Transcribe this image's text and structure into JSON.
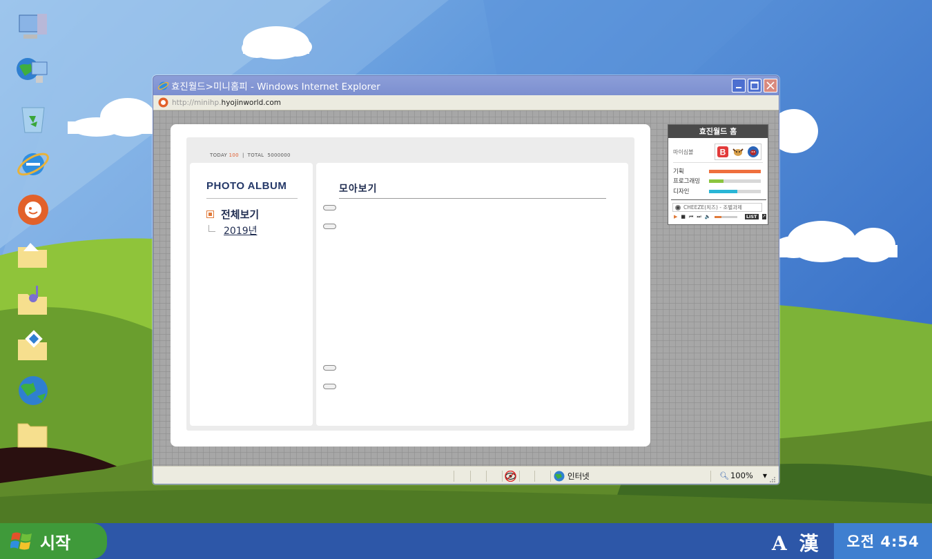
{
  "window": {
    "title": "효진월드>미니홈피 - Windows Internet Explorer",
    "address_prefix": "http://minihp.",
    "address_host": "hyojinworld.com"
  },
  "homepy": {
    "counter_today_label": "TODAY",
    "counter_today_value": "100",
    "counter_sep": "|",
    "counter_total_label": "TOTAL",
    "counter_total_value": "5000000",
    "album_title": "PHOTO ALBUM",
    "menu": [
      {
        "label": "전체보기",
        "selected": true
      },
      {
        "label": "2019년",
        "selected": false
      }
    ],
    "section_title": "모아보기"
  },
  "widget": {
    "title": "효진월드 홈",
    "symbol_label": "마이심볼",
    "symbols": [
      "b-badge-icon",
      "cow-icon",
      "bull-icon"
    ],
    "stats": [
      {
        "label": "기획",
        "level": 1.0,
        "color": "#ef6f3d"
      },
      {
        "label": "프로그래밍",
        "level": 0.28,
        "color": "#8bc53f"
      },
      {
        "label": "디자인",
        "level": 0.55,
        "color": "#29b6d6"
      }
    ],
    "track": "CHEEZE(치즈) - 조별과제",
    "volume_level": 0.3,
    "list_label": "LIST",
    "expand_label": "↗"
  },
  "status": {
    "zone": "인터넷",
    "zoom": "100%"
  },
  "desktop_icons": [
    "my-computer-icon",
    "network-icon",
    "recycle-bin-icon",
    "internet-explorer-icon",
    "cyworld-icon",
    "pictures-folder-icon",
    "music-folder-icon",
    "documents-folder-icon",
    "globe-icon",
    "folder-icon"
  ],
  "taskbar": {
    "start_label": "시작",
    "ime_label": "A 漢",
    "clock": "오전 4:54"
  },
  "colors": {
    "sky": "#4a86d4",
    "hill_light": "#8fc43a",
    "hill_dark": "#3f6f22",
    "taskbar": "#2d57a8",
    "start_green": "#3f9a3a",
    "title_bar": "#8c9ed8",
    "accent_orange": "#e07a3a"
  }
}
